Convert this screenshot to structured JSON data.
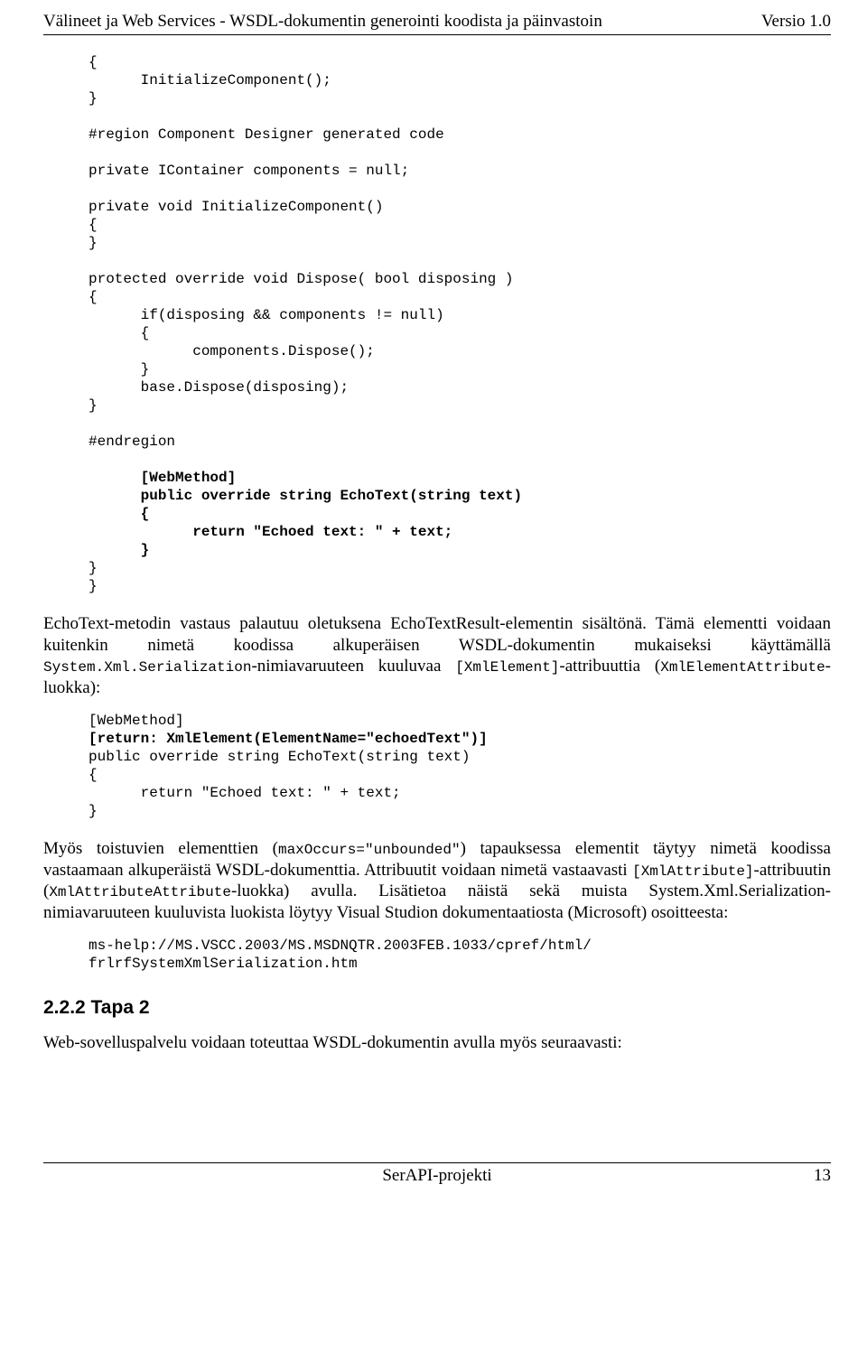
{
  "header": {
    "title": "Välineet ja Web Services - WSDL-dokumentin generointi koodista ja päinvastoin",
    "version_label": "Versio 1.0"
  },
  "code1": {
    "l1": "{",
    "l2": "      InitializeComponent();",
    "l3": "}",
    "l4": "",
    "l5": "#region Component Designer generated code",
    "l6": "",
    "l7": "private IContainer components = null;",
    "l8": "",
    "l9": "private void InitializeComponent()",
    "l10": "{",
    "l11": "}",
    "l12": "",
    "l13": "protected override void Dispose( bool disposing )",
    "l14": "{",
    "l15": "      if(disposing && components != null)",
    "l16": "      {",
    "l17": "            components.Dispose();",
    "l18": "      }",
    "l19": "      base.Dispose(disposing);",
    "l20": "}",
    "l21": "",
    "l22": "#endregion",
    "l23": "",
    "l24": "      [WebMethod]",
    "l25": "      public override string EchoText(string text)",
    "l26": "      {",
    "l27": "            return \"Echoed text: \" + text;",
    "l28": "      }",
    "l29": "}",
    "l30": "}"
  },
  "para1": {
    "t1": "EchoText-metodin vastaus palautuu oletuksena EchoTextResult-elementin sisältönä. Tämä elementti voidaan kuitenkin nimetä koodissa alkuperäisen WSDL-dokumentin mukaiseksi käyttämällä ",
    "m1": "System.Xml.Serialization",
    "t2": "-nimiavaruuteen kuuluvaa ",
    "m2": "[XmlElement]",
    "t3": "-attribuuttia (",
    "m3": "XmlElementAttribute",
    "t4": "-luokka):"
  },
  "code2": {
    "l1": "[WebMethod]",
    "l2": "[return: XmlElement(ElementName=\"echoedText\")]",
    "l3": "public override string EchoText(string text)",
    "l4": "{",
    "l5": "      return \"Echoed text: \" + text;",
    "l6": "}"
  },
  "para2": {
    "t1": "Myös toistuvien elementtien (",
    "m1": "maxOccurs=\"unbounded\"",
    "t2": ") tapauksessa elementit täytyy nimetä koodissa vastaamaan alkuperäistä WSDL-dokumenttia. Attribuutit voidaan nimetä vastaavasti ",
    "m2": "[XmlAttribute]",
    "t3": "-attribuutin (",
    "m3": "XmlAttributeAttribute",
    "t4": "-luokka) avulla. Lisätietoa näistä sekä muista System.Xml.Serialization-nimiavaruuteen kuuluvista luokista löytyy Visual Studion dokumentaatiosta (Microsoft) osoitteesta:"
  },
  "code3": {
    "l1": "ms-help://MS.VSCC.2003/MS.MSDNQTR.2003FEB.1033/cpref/html/",
    "l2": "frlrfSystemXmlSerialization.htm"
  },
  "section222": "2.2.2  Tapa 2",
  "para3": "Web-sovelluspalvelu voidaan toteuttaa WSDL-dokumentin avulla myös seuraavasti:",
  "footer": {
    "center": "SerAPI-projekti",
    "page": "13"
  }
}
